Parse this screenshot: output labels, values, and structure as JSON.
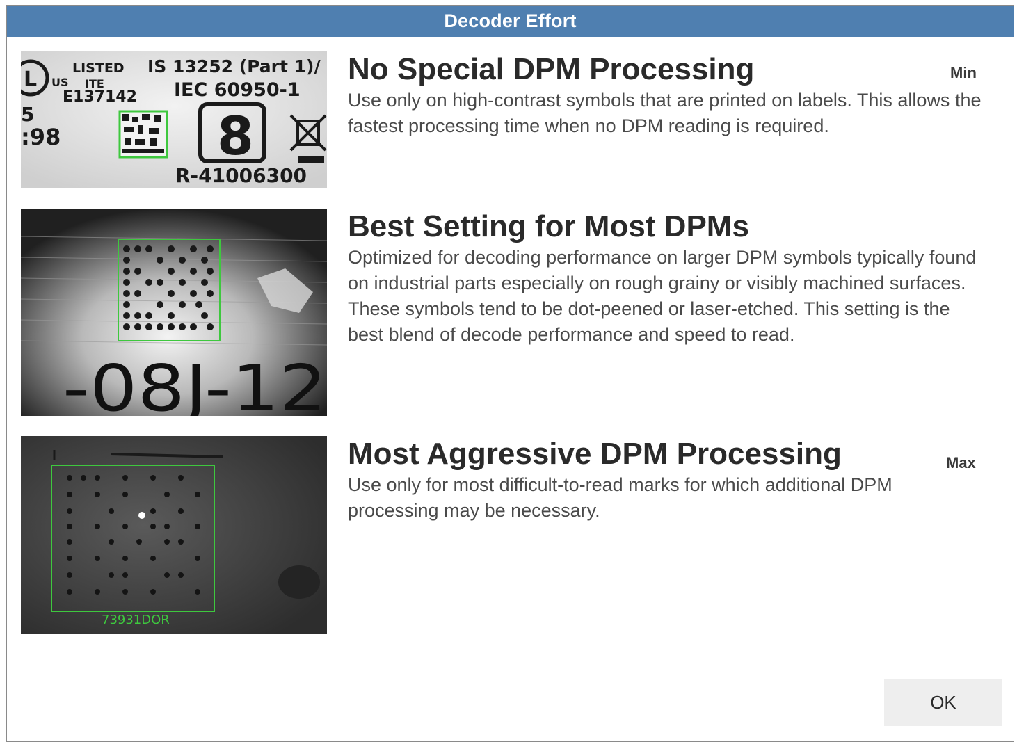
{
  "dialog": {
    "title": "Decoder Effort",
    "ok_label": "OK"
  },
  "options": [
    {
      "heading": "No Special DPM Processing",
      "level": "Min",
      "description": "Use only on high-contrast symbols that are printed on labels. This allows the fastest processing time when no DPM reading is required.",
      "image_labels": {
        "listed": "LISTED",
        "us": "US",
        "ite": "ITE",
        "file": "E137142",
        "standard": "IS 13252 (Part 1)/",
        "iec": "IEC 60950-1",
        "left_top": "5",
        "left_bottom": ":98",
        "registration": "R-41006300"
      }
    },
    {
      "heading": "Best Setting for Most DPMs",
      "level": "",
      "description": "Optimized for decoding performance on larger DPM symbols typically found on industrial parts especially on rough grainy or visibly machined surfaces. These symbols tend to be dot-peened or laser-etched. This setting is the best blend of decode performance and speed to read.",
      "image_labels": {
        "part_number": "-08J-12"
      }
    },
    {
      "heading": "Most Aggressive DPM Processing",
      "level": "Max",
      "description": "Use only for most difficult-to-read marks for which additional DPM processing may be necessary.",
      "image_labels": {
        "decoded": "73931DOR"
      }
    }
  ],
  "colors": {
    "titlebar": "#4f7fb0",
    "decode_box": "#3ec83e",
    "button_bg": "#eeeeee"
  }
}
